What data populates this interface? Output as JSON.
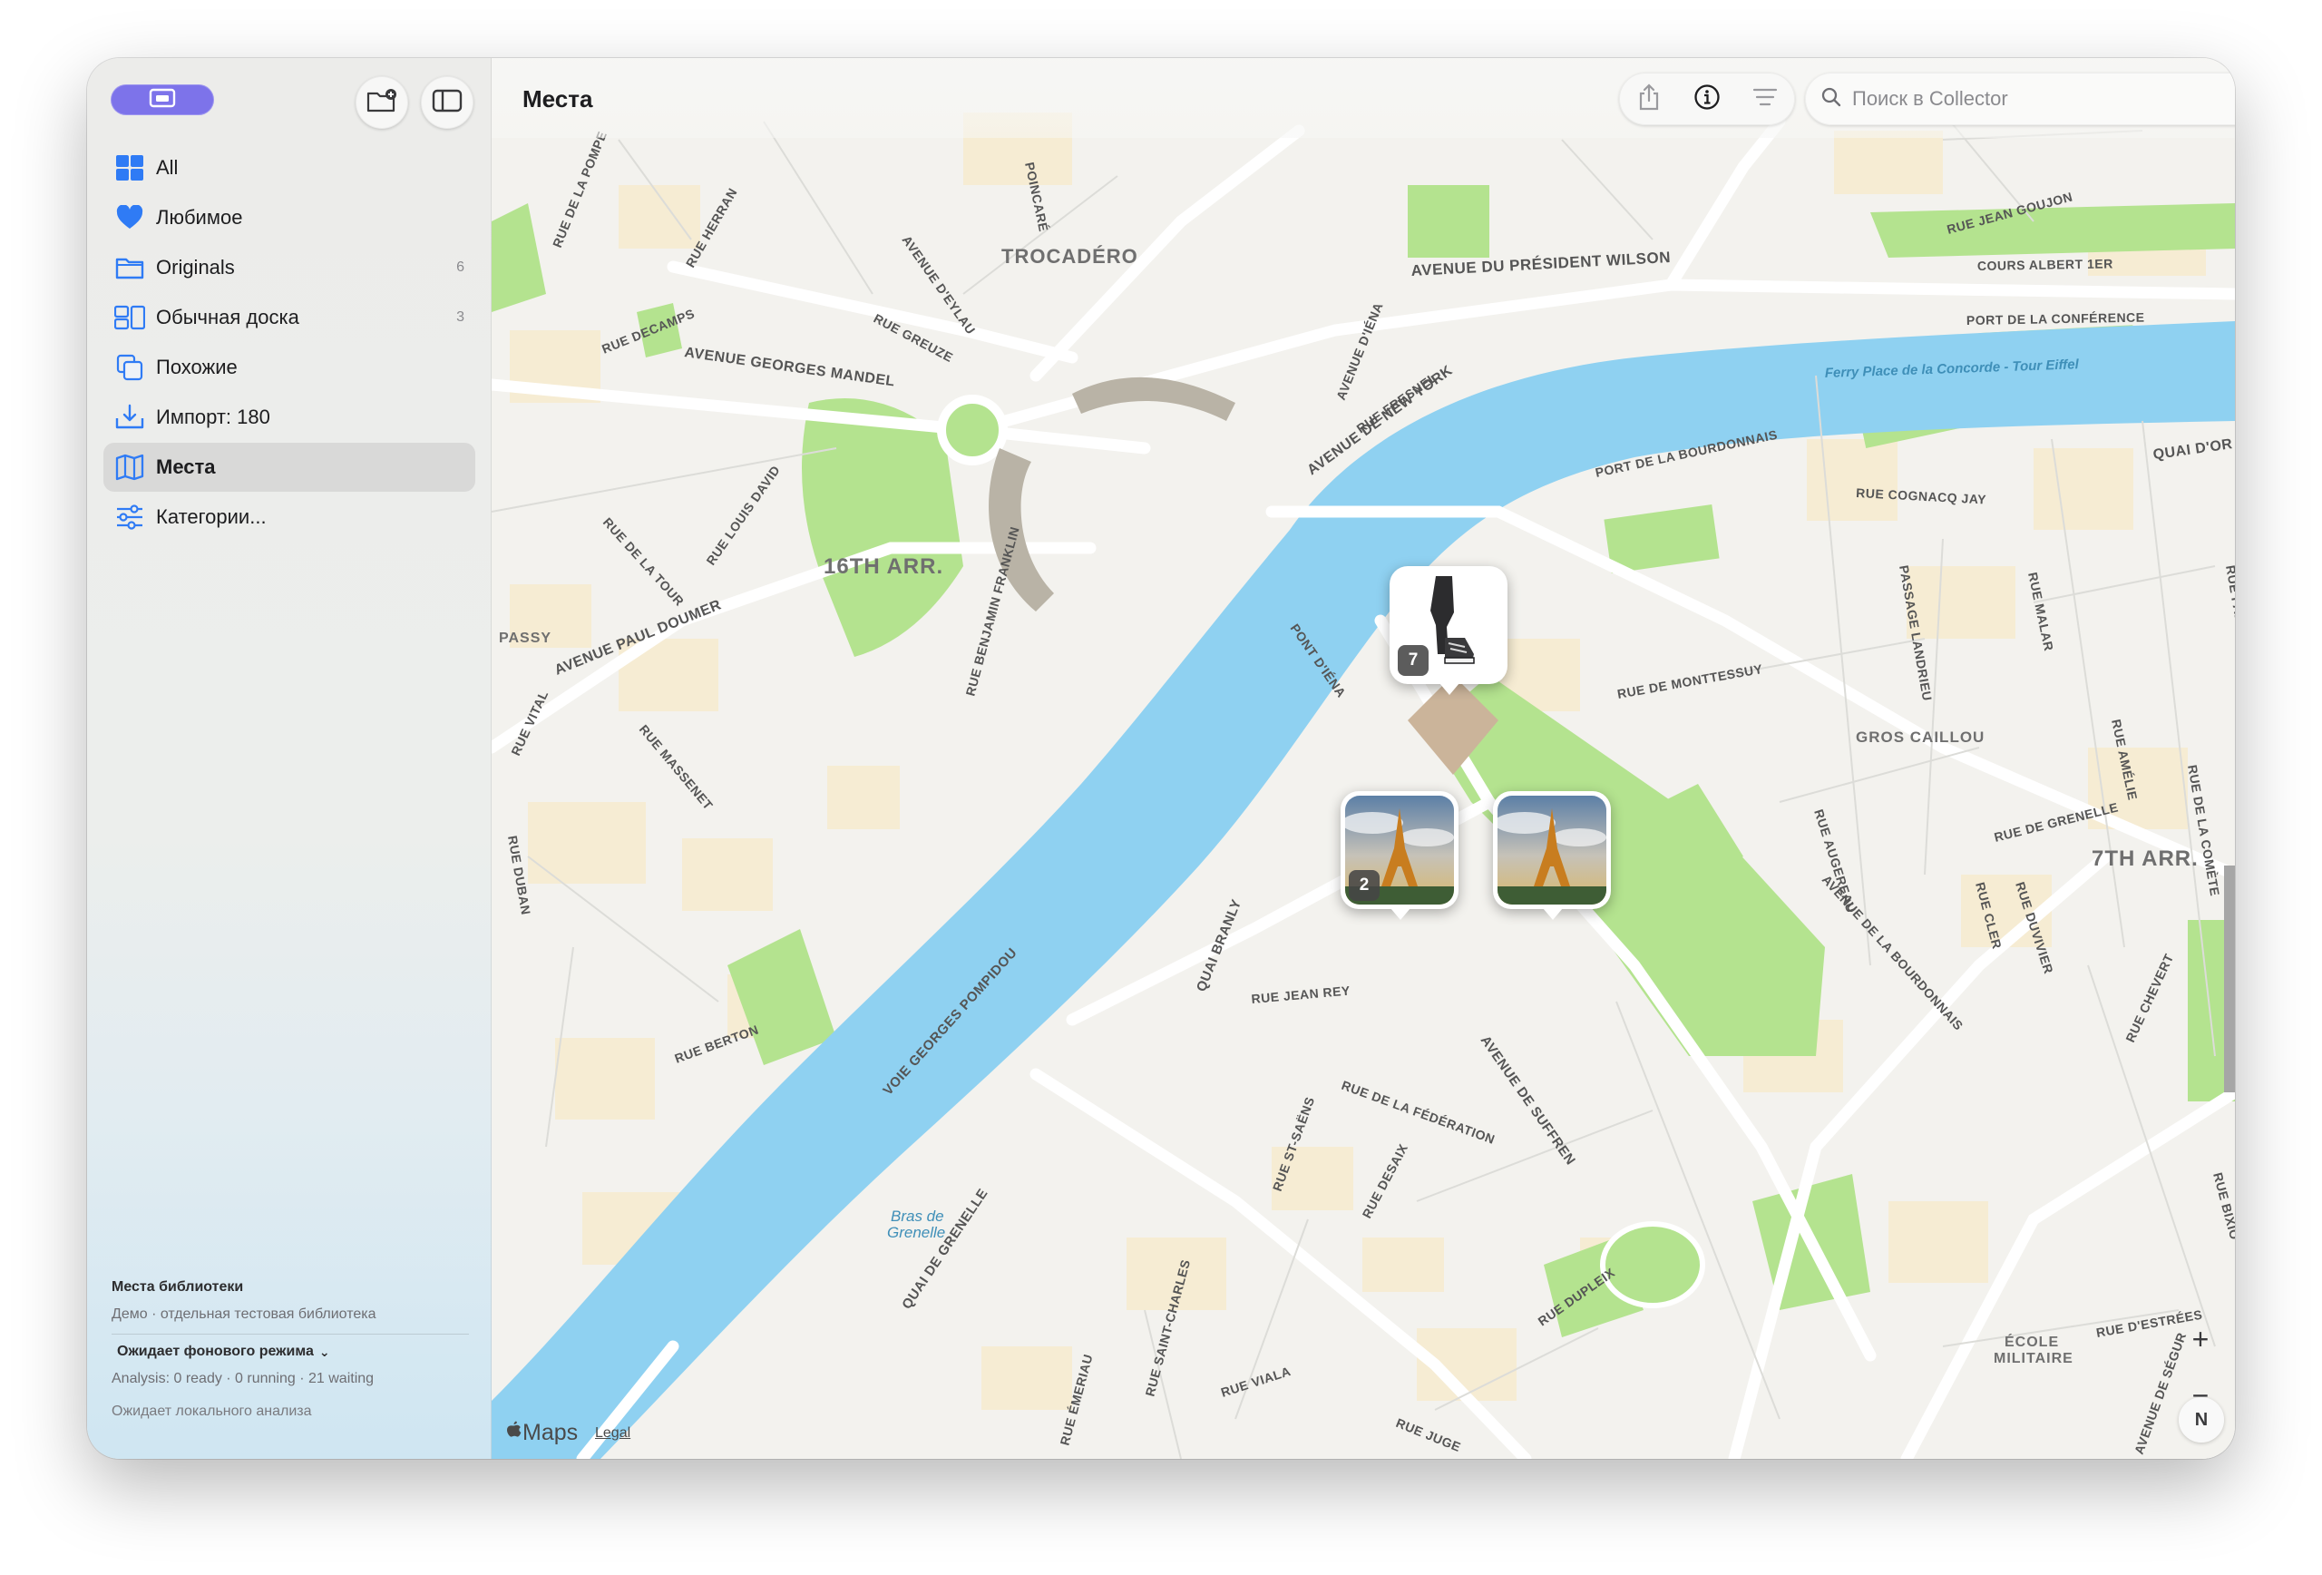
{
  "sidebar": {
    "items": [
      {
        "label": "All",
        "count": "",
        "icon": "grid-icon"
      },
      {
        "label": "Любимое",
        "count": "",
        "icon": "heart-icon"
      },
      {
        "label": "Originals",
        "count": "6",
        "icon": "folder-icon"
      },
      {
        "label": "Обычная доска",
        "count": "3",
        "icon": "board-icon"
      },
      {
        "label": "Похожие",
        "count": "",
        "icon": "similar-icon"
      },
      {
        "label": "Импорт: 180",
        "count": "",
        "icon": "import-tray-icon"
      },
      {
        "label": "Места",
        "count": "",
        "icon": "map-icon",
        "selected": true
      },
      {
        "label": "Категории...",
        "count": "",
        "icon": "sliders-icon"
      }
    ],
    "footer": {
      "library_title": "Места библиотеки",
      "library_subtitle": "Демо · отдельная тестовая библиотека",
      "background_status": "Ожидает фонового режима",
      "analysis": "Analysis: 0 ready · 0 running · 21 waiting",
      "local_status": "Ожидает локального анализа"
    }
  },
  "toolbar": {
    "title": "Места",
    "search_placeholder": "Поиск в Collector",
    "buttons": [
      "share-icon",
      "info-icon",
      "list-icon"
    ]
  },
  "map": {
    "attribution": "Maps",
    "legal": "Legal",
    "compass": "N",
    "zoom_in": "+",
    "zoom_out": "−",
    "pins": [
      {
        "count": "7",
        "subject": "shoes-photo"
      },
      {
        "count": "2",
        "subject": "eiffel-tower-photo"
      },
      {
        "count": "",
        "subject": "eiffel-tower-photo"
      }
    ],
    "districts": [
      "TROCADÉRO",
      "16TH ARR.",
      "7TH ARR.",
      "GROS CAILLOU",
      "PASSY",
      "ÉCOLE",
      "MILITAIRE"
    ],
    "water_labels": [
      "Ferry Place de la Concorde - Tour Eiffel",
      "Bras de",
      "Grenelle"
    ],
    "streets": [
      "AVENUE DU PRÉSIDENT WILSON",
      "AVENUE GEORGES MANDEL",
      "AVENUE DE NEW YORK",
      "AVENUE PAUL DOUMER",
      "PORT DE LA BOURDONNAIS",
      "PORT DE LA CONFÉRENCE",
      "COURS ALBERT 1ER",
      "RUE JEAN GOUJON",
      "QUAI D'OR",
      "RUE COGNACQ JAY",
      "RUE DE MONTTESSUY",
      "RUE DE GRENELLE",
      "RUE JEAN REY",
      "QUAI BRANLY",
      "VOIE GEORGES POMPIDOU",
      "QUAI DE GRENELLE",
      "AVENUE DE SUFFREN",
      "RUE DE LA FÉDÉRATION",
      "RUE DESAIX",
      "RUE ST-SAËNS",
      "RUE DUPLEIX",
      "RUE VIALA",
      "RUE SAINT-CHARLES",
      "RUE ÉMERIAU",
      "RUE JUGE",
      "RUE BERTON",
      "RUE DUBAN",
      "RUE VITAL",
      "RUE MASSENET",
      "RUE DE LA TOUR",
      "RUE LOUIS DAVID",
      "RUE BENJAMIN FRANKLIN",
      "PONT D'IÉNA",
      "AVENUE D'IÉNA",
      "RUE FRESNEL",
      "RUE DECAMPS",
      "RUE GREUZE",
      "AVENUE D'EYLAU",
      "RUE HERRAN",
      "RUE DE LA POMPE",
      "POINCARÉ",
      "PASSAGE LANDRIEU",
      "RUE MALAR",
      "RUE AMÉLIE",
      "RUE DE LA COMÈTE",
      "RUE AUGEREAU",
      "AVENUE DE LA BOURDONNAIS",
      "RUE CLER",
      "RUE DUVIVIER",
      "RUE CHEVERT",
      "RUE D'ESTRÉES",
      "AVENUE DE SÉGUR",
      "RUE BIXIO",
      "RUE FABERT"
    ]
  }
}
